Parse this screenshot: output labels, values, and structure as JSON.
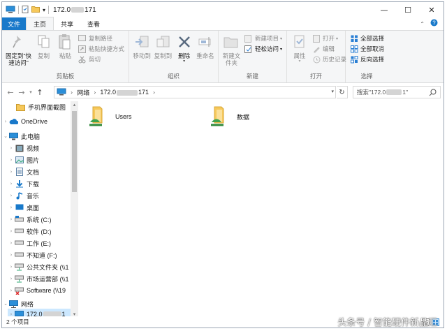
{
  "window": {
    "title_prefix": "172.0",
    "title_suffix": "171",
    "minimize": "—",
    "maximize": "☐",
    "close": "✕"
  },
  "ribbon_tabs": [
    "文件",
    "主页",
    "共享",
    "查看"
  ],
  "ribbon": {
    "clipboard": {
      "label": "剪贴板",
      "pin": "固定到\"快速访问\"",
      "copy": "复制",
      "paste": "粘贴",
      "copy_path": "复制路径",
      "paste_shortcut": "粘贴快捷方式",
      "cut": "剪切"
    },
    "organize": {
      "label": "组织",
      "move_to": "移动到",
      "copy_to": "复制到",
      "delete": "删除",
      "rename": "重命名"
    },
    "new": {
      "label": "新建",
      "new_folder": "新建文件夹",
      "new_item": "新建项目",
      "easy_access": "轻松访问"
    },
    "open": {
      "label": "打开",
      "properties": "属性",
      "open": "打开",
      "edit": "编辑",
      "history": "历史记录"
    },
    "select": {
      "label": "选择",
      "select_all": "全部选择",
      "select_none": "全部取消",
      "invert": "反向选择"
    }
  },
  "address": {
    "crumb_network": "网络",
    "crumb_host_prefix": "172.0",
    "crumb_host_suffix": "171",
    "search_placeholder": "搜索\"172.0",
    "search_suffix": "1\""
  },
  "nav": [
    {
      "label": "手机界面截图",
      "icon": "folder-icon"
    },
    {
      "label": "OneDrive",
      "icon": "onedrive-icon"
    },
    {
      "label": "此电脑",
      "icon": "pc-icon"
    },
    {
      "label": "视频",
      "icon": "video-icon"
    },
    {
      "label": "图片",
      "icon": "pictures-icon"
    },
    {
      "label": "文档",
      "icon": "documents-icon"
    },
    {
      "label": "下载",
      "icon": "download-icon"
    },
    {
      "label": "音乐",
      "icon": "music-icon"
    },
    {
      "label": "桌面",
      "icon": "desktop-icon"
    },
    {
      "label": "系统 (C:)",
      "icon": "drive-icon"
    },
    {
      "label": "软件 (D:)",
      "icon": "drive-icon"
    },
    {
      "label": "工作 (E:)",
      "icon": "drive-icon"
    },
    {
      "label": "不知道 (F:)",
      "icon": "drive-icon"
    },
    {
      "label": "公共文件夹 (\\\\1",
      "icon": "network-drive-icon"
    },
    {
      "label": "市场运营部 (\\\\1",
      "icon": "network-drive-icon"
    },
    {
      "label": "Software (\\\\19",
      "icon": "network-drive-error-icon"
    },
    {
      "label": "网络",
      "icon": "network-icon"
    },
    {
      "label": "172.0",
      "label_suffix": "1",
      "icon": "host-icon"
    }
  ],
  "content": {
    "items": [
      {
        "name": "Users",
        "icon": "shared-folder-icon"
      },
      {
        "name": "数据",
        "icon": "shared-folder-icon"
      }
    ]
  },
  "status": {
    "count": "2 个项目"
  },
  "watermark": "头条号 / 智能硬件新品汇"
}
